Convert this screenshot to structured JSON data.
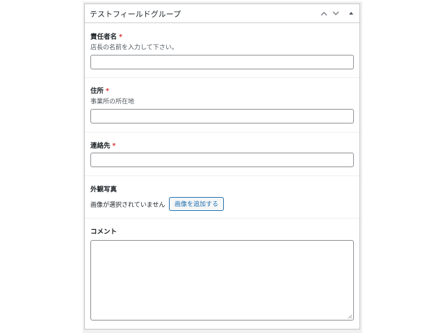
{
  "panel": {
    "title": "テストフィールドグループ",
    "controls": [
      "chevron-up-icon",
      "chevron-down-icon",
      "triangle-up-icon"
    ]
  },
  "fields": {
    "manager": {
      "label": "責任者名",
      "required": "*",
      "description": "店長の名前を入力して下さい。",
      "value": ""
    },
    "address": {
      "label": "住所",
      "required": "*",
      "description": "事業所の所在地",
      "value": ""
    },
    "contact": {
      "label": "連絡先",
      "required": "*",
      "value": ""
    },
    "photo": {
      "label": "外観写真",
      "no_image_text": "画像が選択されていません",
      "add_button": "画像を追加する"
    },
    "comment": {
      "label": "コメント",
      "value": ""
    }
  },
  "colors": {
    "required": "#d63638",
    "button_accent": "#2271b1",
    "border": "#c3c4c7"
  }
}
